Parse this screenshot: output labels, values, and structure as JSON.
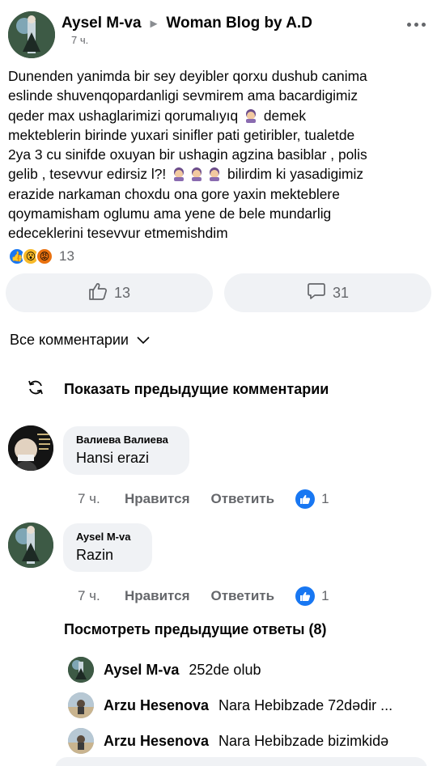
{
  "post": {
    "author": "Aysel M-va",
    "group": "Woman Blog by A.D",
    "time": "7 ч.",
    "lines": [
      "Dunenden yanimda bir sey deyibler qorxu dushub canima",
      "eslinde shuvenqopardanligi sevmirem ama bacardigimiz",
      "qeder max ushaglarimizi qorumalıyıq",
      "demek",
      "mekteblerin birinde yuxari sinifler pati getiribler, tualetde",
      "2ya 3  cu sinifde oxuyan bir ushagin agzina basiblar , polis",
      "gelib , tesevvur edirsiz l?!",
      "bilirdim ki yasadigimiz",
      "erazide narkaman choxdu ona gore yaxin mekteblere",
      "qoymamisham oglumu ama yene de bele mundarlig",
      "edeceklerini tesevvur etmemishdim"
    ],
    "reaction_count": "13",
    "like_count": "13",
    "comment_count": "31"
  },
  "comments_header": {
    "filter_label": "Все комментарии",
    "show_previous": "Показать предыдущие комментарии"
  },
  "comments": [
    {
      "name": "Валиева Валиева",
      "text": "Hansi erazi",
      "time": "7 ч.",
      "like_label": "Нравится",
      "reply_label": "Ответить",
      "likes": "1"
    },
    {
      "name": "Aysel M-va",
      "text": "Razin",
      "time": "7 ч.",
      "like_label": "Нравится",
      "reply_label": "Ответить",
      "likes": "1"
    }
  ],
  "replies_header": "Посмотреть предыдущие ответы (8)",
  "replies": [
    {
      "name": "Aysel M-va",
      "text": "252de olub"
    },
    {
      "name": "Arzu Hesenova",
      "text": "Nara Hebibzade 72dədir ..."
    },
    {
      "name": "Arzu Hesenova",
      "text": "Nara Hebibzade bizimkidə"
    }
  ],
  "icons": [
    "more-icon",
    "thumbs-up-icon",
    "comment-icon",
    "chevron-down-icon",
    "refresh-icon",
    "like-reaction-icon"
  ],
  "colors": {
    "accent": "#1877f2",
    "bubble": "#f0f2f5",
    "muted": "#65676b"
  }
}
